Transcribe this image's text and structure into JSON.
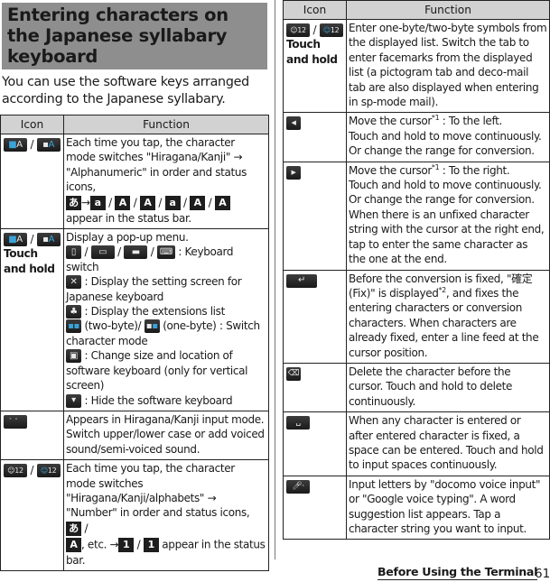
{
  "heading": "Entering characters on the Japanese syllabary keyboard",
  "intro": "You can use the software keys arranged according to the Japanese syllabary.",
  "table_headers": {
    "icon": "Icon",
    "function": "Function"
  },
  "left_rows": [
    {
      "icons": [
        "mode-switch-hiragana-icon",
        "mode-switch-alpha-icon"
      ],
      "separator": "/",
      "function_parts": {
        "text1": "Each time you tap, the character mode switches \"Hiragana/Kanji\" → \"Alphanumeric\" in order and status icons,",
        "status_icons": [
          "あ",
          "a",
          "A",
          "A",
          "a",
          "A",
          "A"
        ],
        "arrow": "→",
        "text2": "appear in the status bar."
      }
    },
    {
      "icons": [
        "mode-switch-hiragana-icon",
        "mode-switch-alpha-icon"
      ],
      "separator": "/",
      "hold_label": "Touch and hold",
      "function_parts": {
        "line1": "Display a pop-up menu.",
        "keyboard_switch": ": Keyboard switch",
        "settings": ": Display the setting screen for Japanese keyboard",
        "extensions": ": Display the extensions list",
        "two_byte": "(two-byte)/",
        "one_byte": "(one-byte) : Switch character mode",
        "resize": ": Change size and location of software keyboard (only for vertical screen)",
        "hide": ": Hide the software keyboard"
      }
    },
    {
      "icons": [
        "voiced-sound-icon"
      ],
      "function": "Appears in Hiragana/Kanji input mode. Switch upper/lower case or add voiced sound/semi-voiced sound."
    },
    {
      "icons": [
        "symbol-mode-icon",
        "symbol-mode-active-icon"
      ],
      "separator": "/",
      "function_parts": {
        "text1": "Each time you tap, the character mode switches \"Hiragana/Kanji/alphabets\" → \"Number\" in order and status icons,",
        "status_a": "あ",
        "status_A": "A",
        "etc": ", etc. →",
        "status_1a": "1",
        "status_1b": "1",
        "text2": "appear in the status bar."
      }
    }
  ],
  "right_rows": [
    {
      "icons": [
        "symbol-mode-icon",
        "symbol-mode-active-icon"
      ],
      "separator": "/",
      "hold_label": "Touch and hold",
      "function": "Enter one-byte/two-byte symbols from the displayed list. Switch the tab to enter facemarks from the displayed list (a pictogram tab and deco-mail tab are also displayed when entering in sp-mode mail)."
    },
    {
      "icons": [
        "cursor-left-icon"
      ],
      "function_parts": {
        "a": "Move the cursor",
        "sup": "*1",
        "b": " : To the left.",
        "c": "Touch and hold to move continuously. Or change the range for conversion."
      }
    },
    {
      "icons": [
        "cursor-right-icon"
      ],
      "function_parts": {
        "a": "Move the cursor",
        "sup": "*1",
        "b": " : To the right.",
        "c": "Touch and hold to move continuously. Or change the range for conversion. When there is an unfixed character string with the cursor at the right end, tap to enter the same character as the one at the end."
      }
    },
    {
      "icons": [
        "enter-icon"
      ],
      "function_parts": {
        "a": "Before the conversion is fixed, \"確定 (Fix)\" is displayed",
        "sup": "*2",
        "b": ", and fixes the entering characters or conversion characters. When characters are already fixed, enter a line feed at the cursor position."
      }
    },
    {
      "icons": [
        "backspace-icon"
      ],
      "function": "Delete the character before the cursor. Touch and hold to delete continuously."
    },
    {
      "icons": [
        "space-icon"
      ],
      "function": "When any character is entered or after entered character is fixed, a space can be entered. Touch and hold to input spaces continuously."
    },
    {
      "icons": [
        "voice-input-icon"
      ],
      "function": "Input letters by \"docomo voice input\" or \"Google voice typing\". A word suggestion list appears. Tap a character string you want to input."
    }
  ],
  "footer": {
    "section": "Before Using the Terminal",
    "page": "61"
  },
  "colors": {
    "heading_bg": "#8e8e8e",
    "header_bg": "#d2d2d2",
    "icon_accent": "#3aa3d8"
  }
}
